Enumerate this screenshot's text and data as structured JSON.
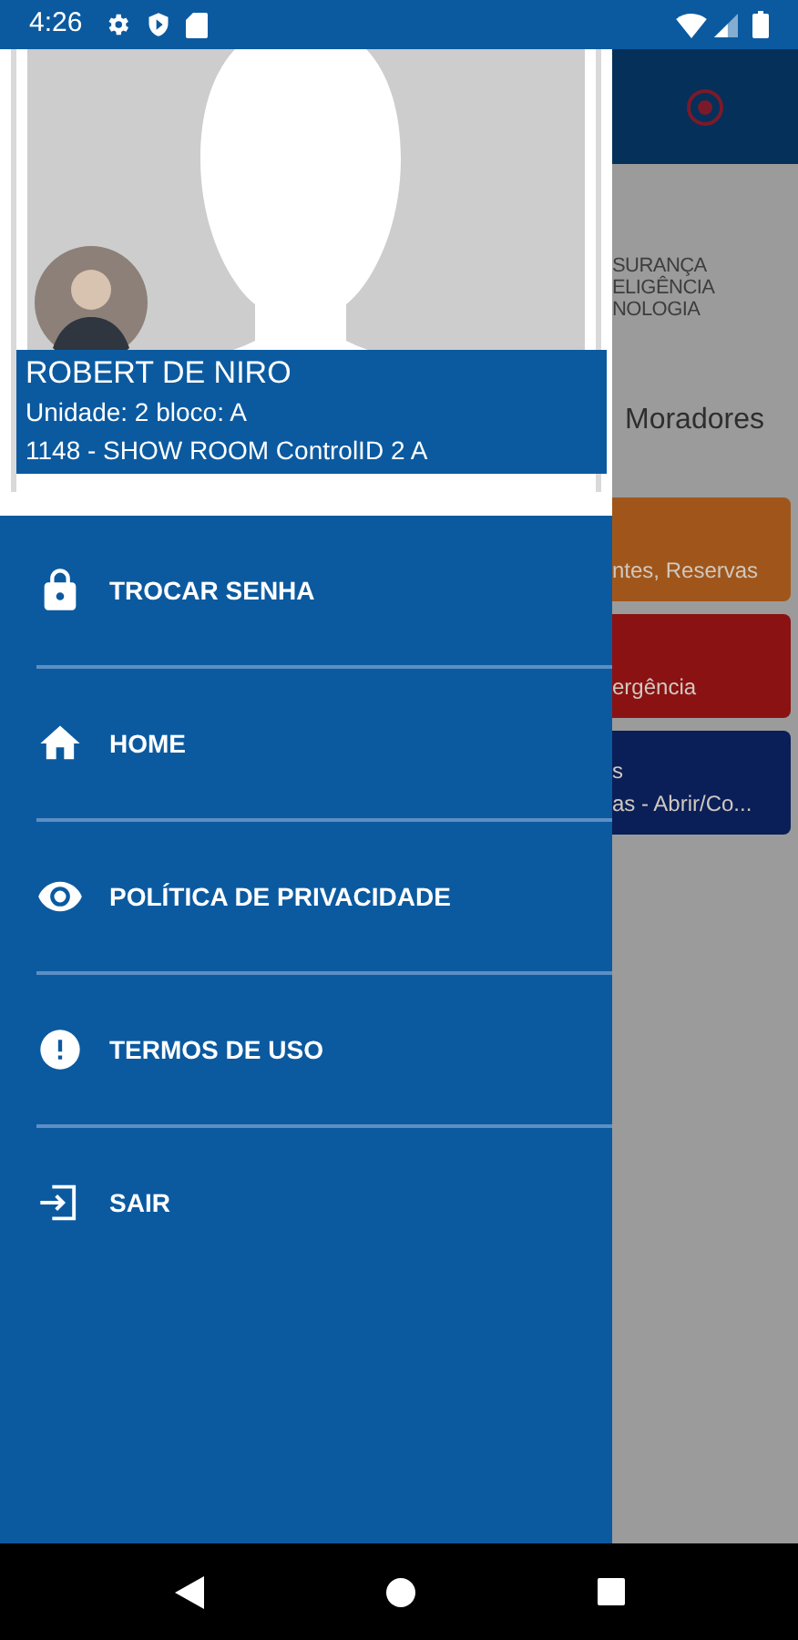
{
  "status_bar": {
    "time": "4:26"
  },
  "profile": {
    "name": "ROBERT DE NIRO",
    "unit": "Unidade: 2 bloco: A",
    "location": "1148 - SHOW ROOM ControlID 2 A"
  },
  "menu": [
    {
      "label": "TROCAR SENHA",
      "kind": "lock"
    },
    {
      "label": "HOME",
      "kind": "home"
    },
    {
      "label": "POLÍTICA DE PRIVACIDADE",
      "kind": "eye"
    },
    {
      "label": "TERMOS DE USO",
      "kind": "alert"
    },
    {
      "label": "SAIR",
      "kind": "logout"
    }
  ],
  "background": {
    "brand_lines": [
      "SURANÇA",
      "ELIGÊNCIA",
      "NOLOGIA"
    ],
    "title": "Moradores",
    "cards": [
      {
        "lines": [
          "ntes, Reservas"
        ],
        "color": "#a0561a"
      },
      {
        "lines": [
          "ergência"
        ],
        "color": "#8a1212"
      },
      {
        "lines": [
          "s",
          "as - Abrir/Co..."
        ],
        "color": "#0a1f57"
      }
    ]
  }
}
